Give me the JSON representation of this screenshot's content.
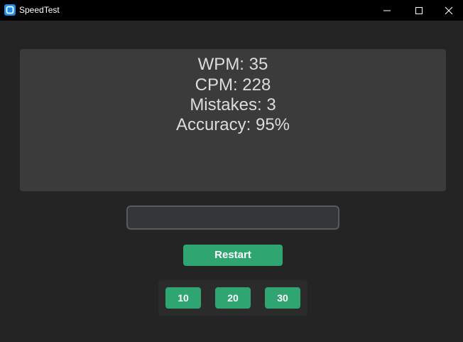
{
  "window": {
    "title": "SpeedTest",
    "icon": "app-icon"
  },
  "results": {
    "wpm_text": "WPM: 35",
    "cpm_text": "CPM: 228",
    "mistakes_text": "Mistakes: 3",
    "accuracy_text": "Accuracy: 95%"
  },
  "typing_input": {
    "value": "",
    "placeholder": ""
  },
  "controls": {
    "restart_label": "Restart",
    "durations": [
      "10",
      "20",
      "30"
    ]
  },
  "colors": {
    "background": "#242424",
    "titlebar": "#000000",
    "panel": "#3b3b3b",
    "button": "#2fa572",
    "text": "#dcdcdc"
  }
}
